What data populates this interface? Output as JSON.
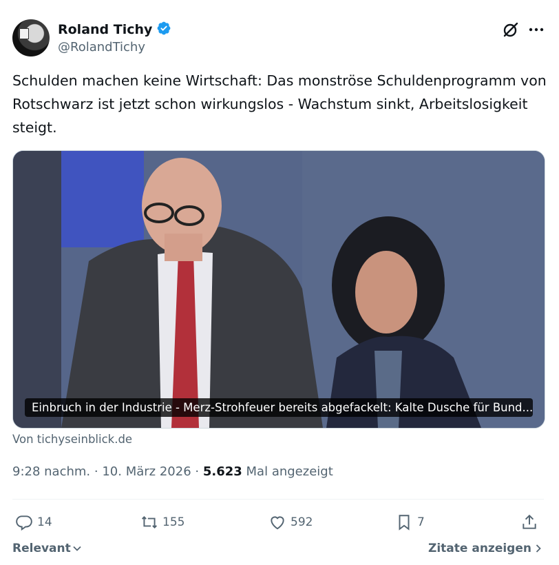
{
  "author": {
    "name": "Roland Tichy",
    "handle": "@RolandTichy",
    "verified": true,
    "verified_color": "#1d9bf0"
  },
  "tweet": {
    "text": "Schulden machen keine Wirtschaft: Das monströse Schuldenprogramm von Rotschwarz ist jetzt schon wirkungslos - Wachstum sinkt, Arbeitslosigkeit steigt."
  },
  "media": {
    "caption": "Einbruch in der Industrie - Merz-Strohfeuer bereits abgefackelt: Kalte Dusche für Bund...",
    "source": "Von tichyseinblick.de"
  },
  "meta": {
    "time": "9:28 nachm.",
    "separator": "·",
    "date": "10. März 2026",
    "views_count": "5.623",
    "views_label": "Mal angezeigt"
  },
  "actions": {
    "replies": "14",
    "reposts": "155",
    "likes": "592",
    "bookmarks": "7"
  },
  "footer": {
    "sort_label": "Relevant",
    "quotes_label": "Zitate anzeigen"
  },
  "icons": {
    "grok": "grok-icon",
    "more": "more-icon",
    "reply": "reply-icon",
    "repost": "repost-icon",
    "like": "heart-icon",
    "bookmark": "bookmark-icon",
    "share": "share-icon"
  },
  "colors": {
    "text": "#0f1419",
    "secondary": "#536471",
    "accent": "#1d9bf0"
  }
}
